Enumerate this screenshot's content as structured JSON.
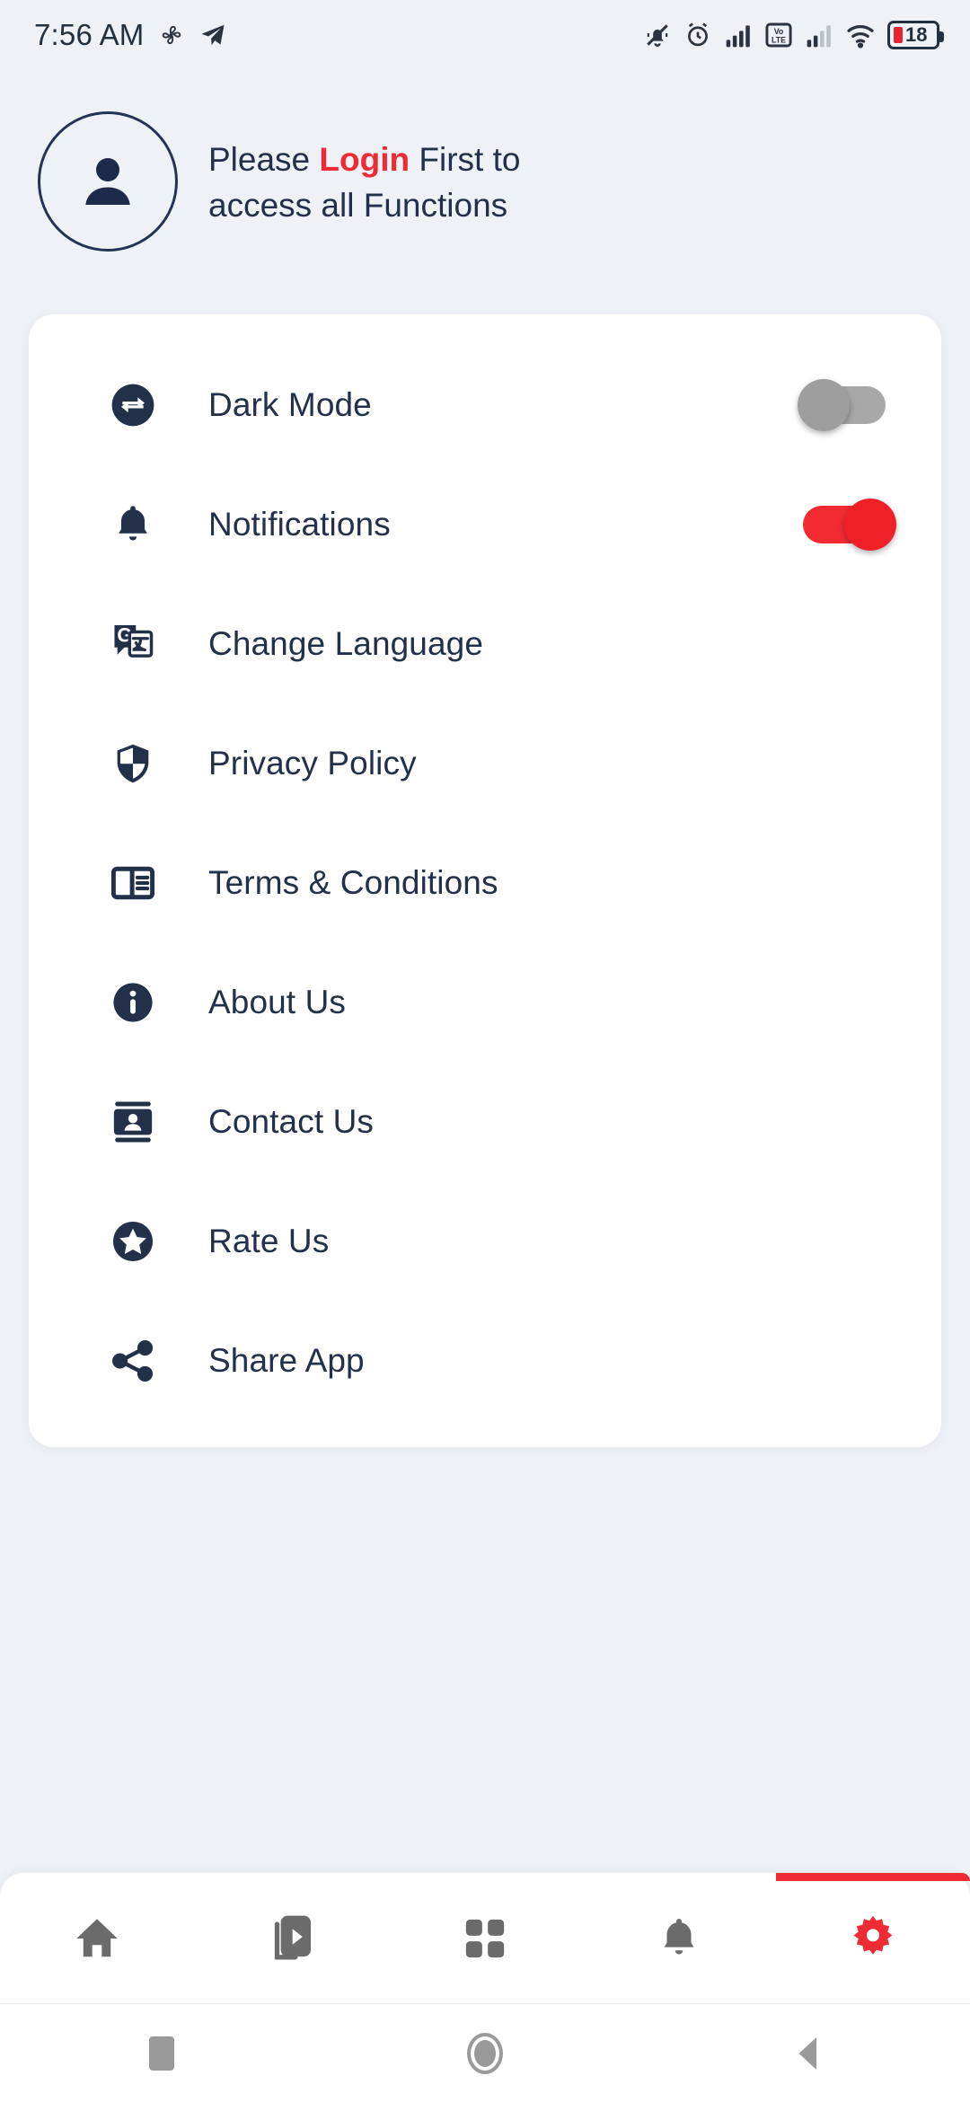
{
  "statusbar": {
    "time": "7:56 AM",
    "battery_level": "18",
    "left_icons": [
      "fan-icon",
      "telegram-icon"
    ],
    "right_icons": [
      "silent-bell-icon",
      "alarm-icon",
      "signal-icon",
      "volte-icon",
      "signal2-icon",
      "wifi-icon",
      "battery-icon"
    ]
  },
  "header": {
    "avatar_icon": "person-icon",
    "text_before": "Please ",
    "highlight": "Login",
    "text_after": " First to access all Functions"
  },
  "colors": {
    "accent_red": "#ee2a33",
    "navy": "#22304a",
    "page_bg": "#eef2f7",
    "card_bg": "#ffffff"
  },
  "menu": [
    {
      "label": "Dark Mode",
      "icon": "swap-arrows-circle-icon",
      "control": "toggle",
      "state": "off"
    },
    {
      "label": "Notifications",
      "icon": "bell-icon",
      "control": "toggle",
      "state": "on"
    },
    {
      "label": "Change Language",
      "icon": "translate-icon",
      "control": "none",
      "state": ""
    },
    {
      "label": "Privacy Policy",
      "icon": "shield-icon",
      "control": "none",
      "state": ""
    },
    {
      "label": "Terms & Conditions",
      "icon": "article-icon",
      "control": "none",
      "state": ""
    },
    {
      "label": "About Us",
      "icon": "info-circle-icon",
      "control": "none",
      "state": ""
    },
    {
      "label": "Contact Us",
      "icon": "contact-card-icon",
      "control": "none",
      "state": ""
    },
    {
      "label": "Rate Us",
      "icon": "star-circle-icon",
      "control": "none",
      "state": ""
    },
    {
      "label": "Share App",
      "icon": "share-icon",
      "control": "none",
      "state": ""
    }
  ],
  "bottom_nav": [
    {
      "name": "home",
      "icon": "home-icon",
      "active": false
    },
    {
      "name": "videos",
      "icon": "video-icon",
      "active": false
    },
    {
      "name": "categories",
      "icon": "grid-icon",
      "active": false
    },
    {
      "name": "notifications",
      "icon": "bell-icon",
      "active": false
    },
    {
      "name": "settings",
      "icon": "gear-icon",
      "active": true
    }
  ],
  "system_nav": [
    {
      "name": "recents",
      "icon": "square-icon"
    },
    {
      "name": "home",
      "icon": "circle-icon"
    },
    {
      "name": "back",
      "icon": "triangle-left-icon"
    }
  ]
}
